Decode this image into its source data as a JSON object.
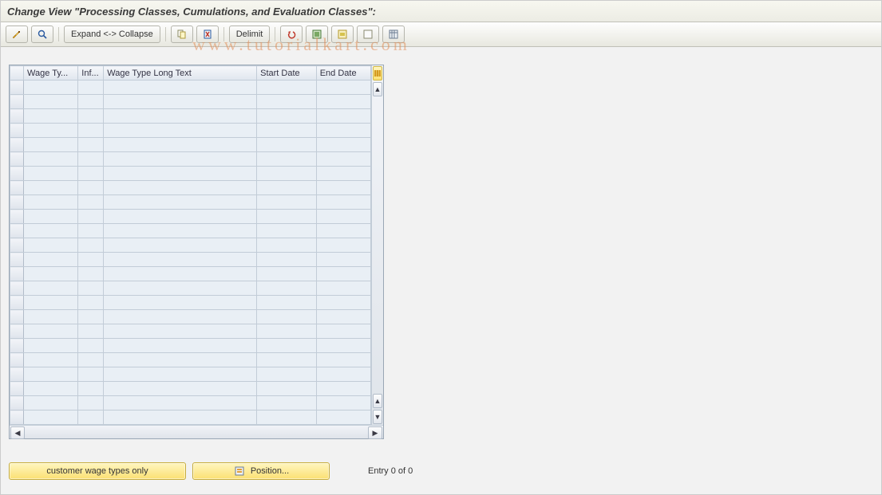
{
  "title": "Change View \"Processing Classes, Cumulations, and Evaluation Classes\":",
  "toolbar": {
    "expand_collapse_label": "Expand <-> Collapse",
    "delimit_label": "Delimit"
  },
  "table": {
    "columns": [
      {
        "label": "Wage Ty...",
        "width": 64
      },
      {
        "label": "Inf...",
        "width": 30
      },
      {
        "label": "Wage Type Long Text",
        "width": 180
      },
      {
        "label": "Start Date",
        "width": 70
      },
      {
        "label": "End Date",
        "width": 64
      }
    ],
    "row_selector_width": 16,
    "empty_row_count": 24
  },
  "footer": {
    "customer_button_label": "customer wage types only",
    "position_button_label": "Position...",
    "status_text": "Entry 0 of 0"
  },
  "watermark": "www.tutorialkart.com"
}
